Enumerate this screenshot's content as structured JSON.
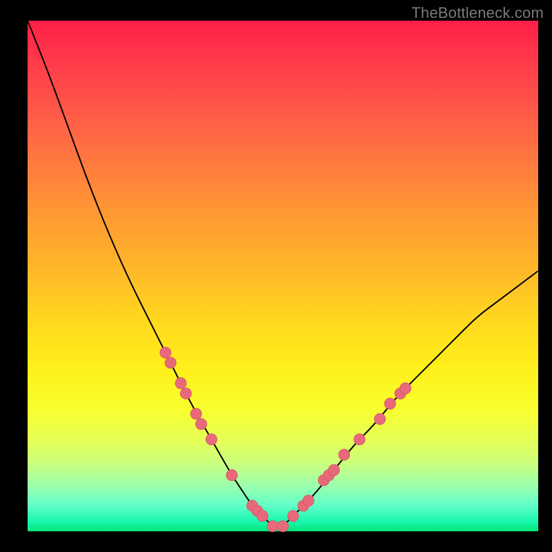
{
  "attribution": "TheBottleneck.com",
  "colors": {
    "background": "#000000",
    "curve": "#000000",
    "marker": "#e86a7a"
  },
  "chart_data": {
    "type": "line",
    "title": "",
    "xlabel": "",
    "ylabel": "",
    "xlim": [
      0,
      100
    ],
    "ylim": [
      0,
      100
    ],
    "x": [
      0,
      4,
      8,
      12,
      16,
      20,
      24,
      28,
      32,
      36,
      40,
      42,
      44,
      46,
      48,
      50,
      52,
      56,
      60,
      64,
      68,
      72,
      76,
      80,
      84,
      88,
      92,
      96,
      100
    ],
    "values": [
      100,
      90,
      79,
      68,
      58,
      49,
      41,
      33,
      25,
      18,
      11,
      8,
      5,
      3,
      1,
      1,
      3,
      7,
      12,
      17,
      21,
      26,
      30,
      34,
      38,
      42,
      45,
      48,
      51
    ],
    "series": [
      {
        "name": "bottleneck-curve",
        "x": [
          0,
          4,
          8,
          12,
          16,
          20,
          24,
          28,
          32,
          36,
          40,
          42,
          44,
          46,
          48,
          50,
          52,
          56,
          60,
          64,
          68,
          72,
          76,
          80,
          84,
          88,
          92,
          96,
          100
        ],
        "y": [
          100,
          90,
          79,
          68,
          58,
          49,
          41,
          33,
          25,
          18,
          11,
          8,
          5,
          3,
          1,
          1,
          3,
          7,
          12,
          17,
          21,
          26,
          30,
          34,
          38,
          42,
          45,
          48,
          51
        ]
      }
    ],
    "markers": [
      {
        "x": 27,
        "y": 35
      },
      {
        "x": 28,
        "y": 33
      },
      {
        "x": 30,
        "y": 29
      },
      {
        "x": 31,
        "y": 27
      },
      {
        "x": 33,
        "y": 23
      },
      {
        "x": 34,
        "y": 21
      },
      {
        "x": 36,
        "y": 18
      },
      {
        "x": 40,
        "y": 11
      },
      {
        "x": 44,
        "y": 5
      },
      {
        "x": 45,
        "y": 4
      },
      {
        "x": 46,
        "y": 3
      },
      {
        "x": 48,
        "y": 1
      },
      {
        "x": 50,
        "y": 1
      },
      {
        "x": 52,
        "y": 3
      },
      {
        "x": 54,
        "y": 5
      },
      {
        "x": 55,
        "y": 6
      },
      {
        "x": 58,
        "y": 10
      },
      {
        "x": 59,
        "y": 11
      },
      {
        "x": 60,
        "y": 12
      },
      {
        "x": 62,
        "y": 15
      },
      {
        "x": 65,
        "y": 18
      },
      {
        "x": 69,
        "y": 22
      },
      {
        "x": 71,
        "y": 25
      },
      {
        "x": 73,
        "y": 27
      },
      {
        "x": 74,
        "y": 28
      }
    ]
  }
}
